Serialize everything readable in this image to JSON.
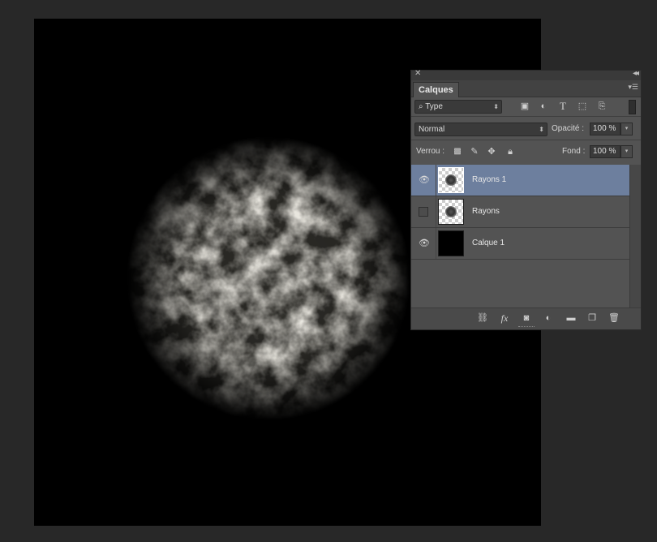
{
  "panel": {
    "tab_label": "Calques",
    "filter": {
      "value": "Type"
    },
    "blend_mode": {
      "value": "Normal"
    },
    "opacity": {
      "label": "Opacité :",
      "value": "100 %"
    },
    "lock": {
      "label": "Verrou :"
    },
    "fill": {
      "label": "Fond :",
      "value": "100 %"
    },
    "layers": [
      {
        "name": "Rayons 1",
        "visible": true,
        "selected": true
      },
      {
        "name": "Rayons",
        "visible": false,
        "selected": false
      },
      {
        "name": "Calque 1",
        "visible": true,
        "selected": false
      }
    ],
    "bottom_icons": [
      "link-icon",
      "fx-icon",
      "mask-icon",
      "adjustment-icon",
      "folder-icon",
      "new-layer-icon",
      "trash-icon"
    ]
  },
  "colors": {
    "selected_layer": "#6d7f9e",
    "canvas": "#000000",
    "app_bg": "#282828"
  }
}
